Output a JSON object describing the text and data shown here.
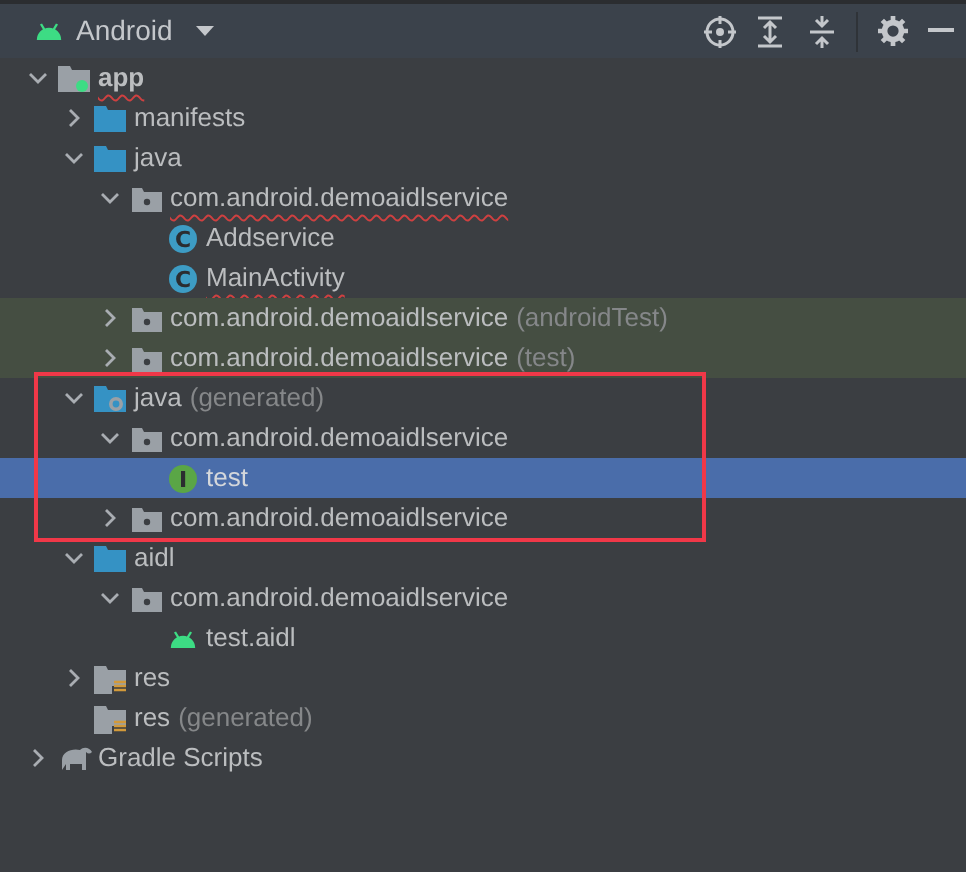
{
  "toolbar": {
    "view": "Android"
  },
  "tree": [
    {
      "label": "app",
      "kind": "module",
      "expanded": true,
      "selected": false,
      "tinted": false,
      "misspelled": true,
      "outlined": false,
      "bold": true,
      "children": [
        {
          "label": "manifests",
          "kind": "folder",
          "expanded": false,
          "selected": false,
          "tinted": false,
          "misspelled": false,
          "outlined": false
        },
        {
          "label": "java",
          "kind": "folder",
          "expanded": true,
          "selected": false,
          "tinted": false,
          "misspelled": false,
          "outlined": false,
          "children": [
            {
              "label": "com.android.demoaidlservice",
              "kind": "package",
              "expanded": true,
              "selected": false,
              "tinted": false,
              "misspelled": true,
              "outlined": false,
              "children": [
                {
                  "label": "Addservice",
                  "kind": "class",
                  "icon_text": "C",
                  "selected": false,
                  "tinted": false,
                  "misspelled": false,
                  "outlined": false
                },
                {
                  "label": "MainActivity",
                  "kind": "class",
                  "icon_text": "C",
                  "selected": false,
                  "tinted": false,
                  "misspelled": true,
                  "outlined": false
                }
              ]
            },
            {
              "label": "com.android.demoaidlservice",
              "suffix": "(androidTest)",
              "kind": "package",
              "expanded": false,
              "selected": false,
              "tinted": true,
              "misspelled": false,
              "outlined": false
            },
            {
              "label": "com.android.demoaidlservice",
              "suffix": "(test)",
              "kind": "package",
              "expanded": false,
              "selected": false,
              "tinted": true,
              "misspelled": false,
              "outlined": false
            }
          ]
        },
        {
          "label": "java",
          "suffix": "(generated)",
          "kind": "generated",
          "expanded": true,
          "selected": false,
          "tinted": false,
          "misspelled": false,
          "outlined": true,
          "children": [
            {
              "label": "com.android.demoaidlservice",
              "kind": "package",
              "expanded": true,
              "selected": false,
              "tinted": false,
              "misspelled": false,
              "outlined": false,
              "children": [
                {
                  "label": "test",
                  "kind": "interface",
                  "icon_text": "I",
                  "selected": true,
                  "tinted": false,
                  "misspelled": false,
                  "outlined": false
                }
              ]
            },
            {
              "label": "com.android.demoaidlservice",
              "kind": "package",
              "expanded": false,
              "selected": false,
              "tinted": false,
              "misspelled": false,
              "outlined": false
            }
          ]
        },
        {
          "label": "aidl",
          "kind": "folder",
          "expanded": true,
          "selected": false,
          "tinted": false,
          "misspelled": false,
          "outlined": false,
          "children": [
            {
              "label": "com.android.demoaidlservice",
              "kind": "package",
              "expanded": true,
              "selected": false,
              "tinted": false,
              "misspelled": false,
              "outlined": false,
              "children": [
                {
                  "label": "test.aidl",
                  "kind": "android",
                  "selected": false,
                  "tinted": false,
                  "misspelled": false,
                  "outlined": false
                }
              ]
            }
          ]
        },
        {
          "label": "res",
          "kind": "res",
          "expanded": false,
          "selected": false,
          "tinted": false,
          "misspelled": false,
          "outlined": false
        },
        {
          "label": "res",
          "suffix": "(generated)",
          "kind": "res",
          "selected": false,
          "tinted": false,
          "misspelled": false,
          "outlined": false
        }
      ]
    },
    {
      "label": "Gradle Scripts",
      "kind": "gradle",
      "expanded": false,
      "selected": false,
      "tinted": false,
      "misspelled": false,
      "outlined": false
    }
  ]
}
